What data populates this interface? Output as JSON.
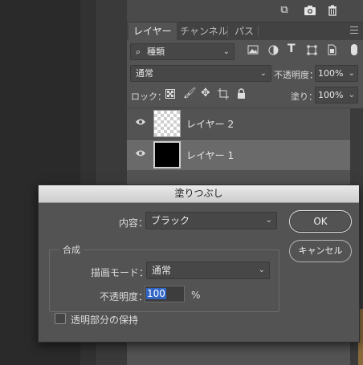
{
  "layers_panel": {
    "tabs": [
      "レイヤー",
      "チャンネル",
      "パス"
    ],
    "filter_label": "種類",
    "blend_mode": "通常",
    "opacity_label": "不透明度：",
    "opacity_value": "100%",
    "lock_label": "ロック：",
    "fill_label": "塗り：",
    "fill_value": "100%",
    "layers": [
      {
        "name": "レイヤー 2"
      },
      {
        "name": "レイヤー 1"
      }
    ]
  },
  "dialog": {
    "title": "塗りつぶし",
    "contents_label": "内容：",
    "contents_value": "ブラック",
    "ok_label": "OK",
    "cancel_label": "キャンセル",
    "group_title": "合成",
    "mode_label": "描画モード：",
    "mode_value": "通常",
    "opacity_label": "不透明度：",
    "opacity_value": "100",
    "percent": "%",
    "preserve_label": "透明部分の保持"
  },
  "icons": {
    "new_layer": "new-layer-icon",
    "camera": "camera-icon",
    "trash": "trash-icon"
  }
}
